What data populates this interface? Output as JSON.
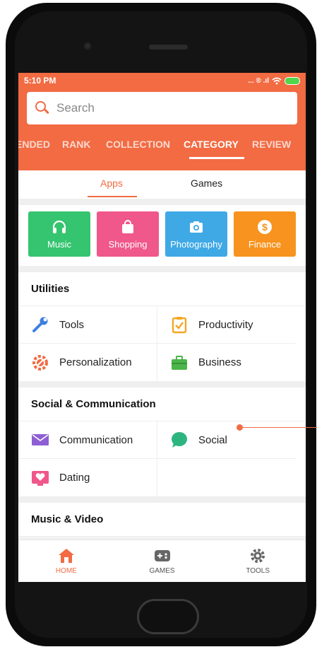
{
  "status_bar": {
    "time": "5:10 PM",
    "icons": "... ® .ıl"
  },
  "search": {
    "placeholder": "Search"
  },
  "tabs": [
    {
      "label": "ENDED",
      "active": false
    },
    {
      "label": "RANK",
      "active": false
    },
    {
      "label": "COLLECTION",
      "active": false
    },
    {
      "label": "CATEGORY",
      "active": true
    },
    {
      "label": "REVIEW",
      "active": false
    }
  ],
  "subtabs": [
    {
      "label": "Apps",
      "active": true
    },
    {
      "label": "Games",
      "active": false
    }
  ],
  "featured": [
    {
      "label": "Music",
      "icon": "headphones-icon",
      "color": "#35c46f"
    },
    {
      "label": "Shopping",
      "icon": "shopping-bag-icon",
      "color": "#f0578a"
    },
    {
      "label": "Photography",
      "icon": "camera-icon",
      "color": "#3fa9e6"
    },
    {
      "label": "Finance",
      "icon": "dollar-icon",
      "color": "#f7931e"
    }
  ],
  "sections": {
    "utilities": {
      "title": "Utilities",
      "items": [
        {
          "label": "Tools",
          "icon": "wrench-icon"
        },
        {
          "label": "Productivity",
          "icon": "clipboard-check-icon"
        },
        {
          "label": "Personalization",
          "icon": "palette-gear-icon"
        },
        {
          "label": "Business",
          "icon": "briefcase-icon"
        }
      ]
    },
    "social": {
      "title": "Social & Communication",
      "items": [
        {
          "label": "Communication",
          "icon": "envelope-icon"
        },
        {
          "label": "Social",
          "icon": "chat-bubble-icon"
        },
        {
          "label": "Dating",
          "icon": "heart-screen-icon"
        }
      ]
    },
    "music_video": {
      "title": "Music & Video"
    }
  },
  "bottom_nav": [
    {
      "label": "HOME",
      "icon": "home-icon",
      "active": true
    },
    {
      "label": "GAMES",
      "icon": "gamepad-icon",
      "active": false
    },
    {
      "label": "TOOLS",
      "icon": "gear-icon",
      "active": false
    }
  ],
  "colors": {
    "accent": "#f26b43"
  }
}
